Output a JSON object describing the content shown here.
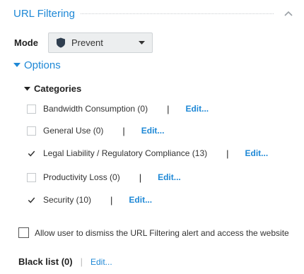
{
  "section": {
    "title": "URL Filtering"
  },
  "mode": {
    "label": "Mode",
    "value": "Prevent"
  },
  "options": {
    "label": "Options"
  },
  "categories": {
    "label": "Categories",
    "items": [
      {
        "label": "Bandwidth Consumption (0)",
        "checked": false,
        "separator": "|",
        "edit": "Edit..."
      },
      {
        "label": "General Use (0)",
        "checked": false,
        "separator": "|",
        "edit": "Edit..."
      },
      {
        "label": "Legal Liability / Regulatory Compliance (13)",
        "checked": true,
        "separator": "|",
        "edit": "Edit..."
      },
      {
        "label": "Productivity Loss (0)",
        "checked": false,
        "separator": "|",
        "edit": "Edit..."
      },
      {
        "label": "Security (10)",
        "checked": true,
        "separator": "|",
        "edit": "Edit..."
      }
    ]
  },
  "allow_dismiss": {
    "label": "Allow user to dismiss the URL Filtering alert and access the website",
    "checked": false
  },
  "blacklist": {
    "label": "Black list (0)",
    "separator": "|",
    "edit": "Edit..."
  },
  "colors": {
    "accent": "#1e88d6",
    "text": "#333333",
    "select_bg": "#eceeef"
  },
  "icons": {
    "collapse": "chevron-up-icon",
    "mode": "shield-icon",
    "dropdown": "caret-down-icon",
    "options": "triangle-down-icon",
    "categories": "triangle-down-icon",
    "check": "checkmark-icon"
  }
}
